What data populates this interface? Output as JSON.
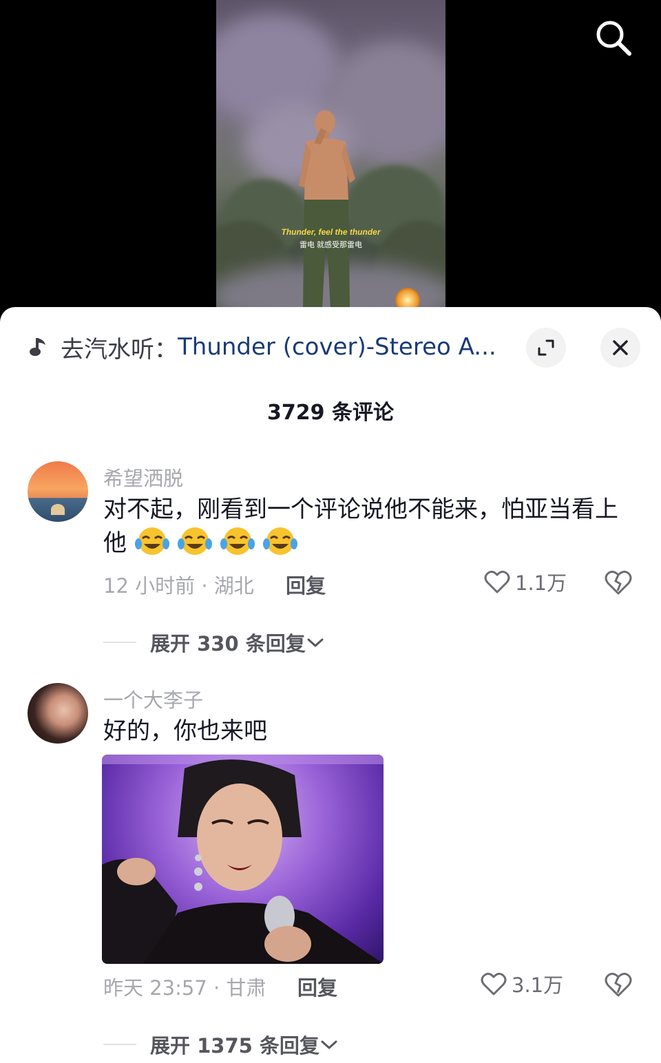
{
  "video": {
    "subtitle_en": "Thunder, feel the thunder",
    "subtitle_cn": "雷电 就感受那雷电",
    "search_icon": "search-icon"
  },
  "sheet": {
    "music_prefix": "去汽水听：",
    "music_title": "Thunder (cover)-Stereo A...",
    "comment_count": "3729 条评论"
  },
  "comments": [
    {
      "username": "希望洒脱",
      "text": "对不起，刚看到一个评论说他不能来，怕亚当看上他",
      "emoji_count": 4,
      "time": "12 小时前 · 湖北",
      "reply": "回复",
      "likes": "1.1万",
      "expand": "展开 330 条回复"
    },
    {
      "username": "一个大李子",
      "text": "好的，你也来吧",
      "time": "昨天 23:57 · 甘肃",
      "reply": "回复",
      "likes": "3.1万",
      "expand": "展开 1375 条回复"
    }
  ],
  "colors": {
    "link": "#1a3a78",
    "meta": "#a7a8ad",
    "text": "#161823"
  }
}
